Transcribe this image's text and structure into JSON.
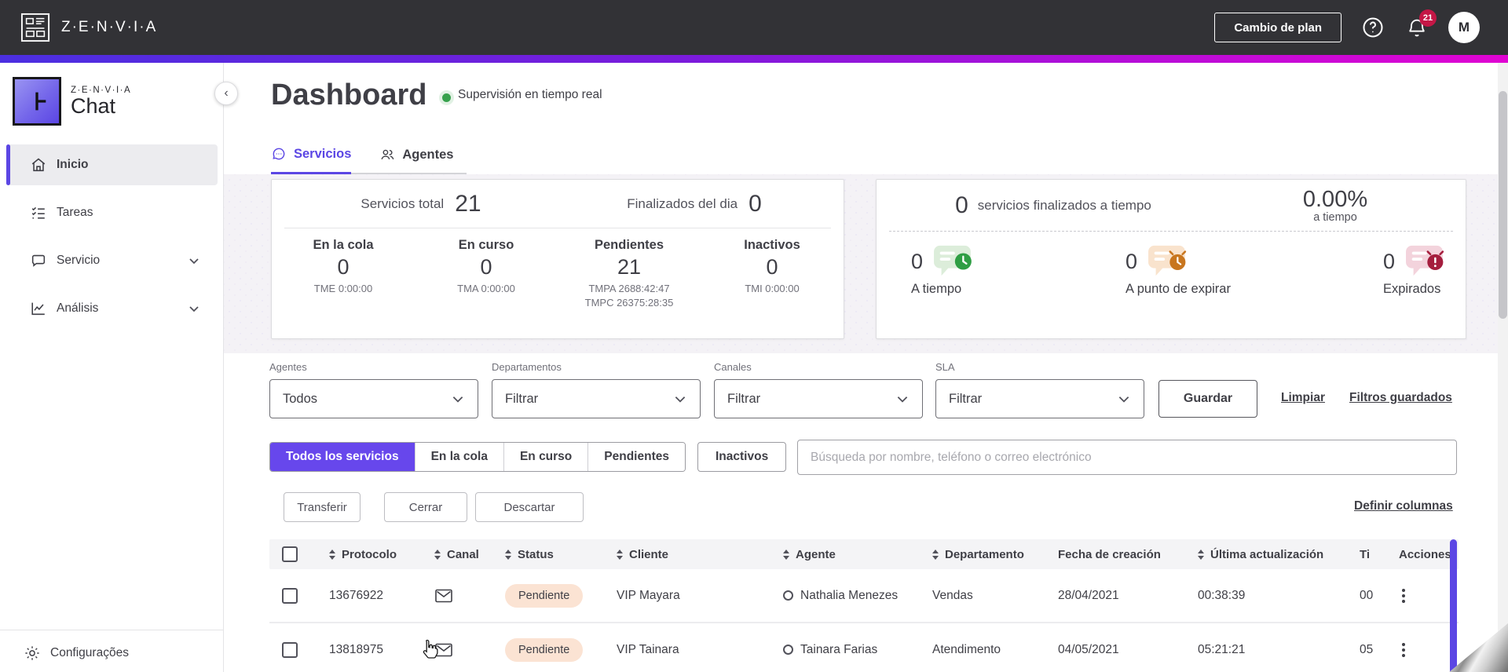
{
  "colors": {
    "accent": "#5b46e4",
    "active_segment": "#6747ec",
    "topbar_bg": "#323236",
    "gradient_start": "#4b2fe0",
    "gradient_end": "#e003d2",
    "status_green": "#36a14c",
    "badge_bg": "#fbe3d3",
    "sla_green": "#2f9e44",
    "sla_orange": "#c8761f",
    "sla_red": "#a51e3e"
  },
  "topbar": {
    "brand": "Z·E·N·V·I·A",
    "change_plan_label": "Cambio de plan",
    "notification_count": "21",
    "avatar_initial": "M"
  },
  "sidebar": {
    "brand": "Z·E·N·V·I·A",
    "product": "Chat",
    "items": [
      {
        "label": "Inicio"
      },
      {
        "label": "Tareas"
      },
      {
        "label": "Servicio"
      },
      {
        "label": "Análisis"
      }
    ],
    "footer_label": "Configurações"
  },
  "header": {
    "title": "Dashboard",
    "status": "Supervisión en tiempo real"
  },
  "tabs": {
    "services": "Servicios",
    "agents": "Agentes"
  },
  "summary": {
    "total_label": "Servicios total",
    "total_value": "21",
    "finished_label": "Finalizados del dia",
    "finished_value": "0",
    "columns": [
      {
        "label": "En la cola",
        "value": "0",
        "metrics": [
          "TME 0:00:00"
        ]
      },
      {
        "label": "En curso",
        "value": "0",
        "metrics": [
          "TMA 0:00:00"
        ]
      },
      {
        "label": "Pendientes",
        "value": "21",
        "metrics": [
          "TMPA 2688:42:47",
          "TMPC 26375:28:35"
        ]
      },
      {
        "label": "Inactivos",
        "value": "0",
        "metrics": [
          "TMI 0:00:00"
        ]
      }
    ]
  },
  "sla": {
    "finished_value": "0",
    "finished_label": "servicios finalizados a tiempo",
    "percent": "0.00%",
    "percent_label": "a tiempo",
    "items": [
      {
        "value": "0",
        "label": "A tiempo"
      },
      {
        "value": "0",
        "label": "A punto de expirar"
      },
      {
        "value": "0",
        "label": "Expirados"
      }
    ]
  },
  "filters": {
    "agents_label": "Agentes",
    "agents_value": "Todos",
    "departments_label": "Departamentos",
    "departments_value": "Filtrar",
    "channels_label": "Canales",
    "channels_value": "Filtrar",
    "sla_label": "SLA",
    "sla_value": "Filtrar",
    "save_label": "Guardar",
    "clear_label": "Limpiar",
    "saved_label": "Filtros guardados"
  },
  "service_tabs": {
    "all": "Todos los servicios",
    "queue": "En la cola",
    "in_progress": "En curso",
    "pending": "Pendientes",
    "inactive": "Inactivos",
    "search_placeholder": "Búsqueda por nombre, teléfono o correo electrónico"
  },
  "actions": {
    "transfer": "Transferir",
    "close": "Cerrar",
    "discard": "Descartar",
    "define_columns": "Definir columnas"
  },
  "table": {
    "headers": {
      "protocol": "Protocolo",
      "channel": "Canal",
      "status": "Status",
      "client": "Cliente",
      "agent": "Agente",
      "department": "Departamento",
      "created": "Fecha de creación",
      "updated": "Última actualización",
      "time": "Ti",
      "actions": "Acciones"
    },
    "rows": [
      {
        "protocolo": "13676922",
        "status": "Pendiente",
        "cliente": "VIP Mayara",
        "agente": "Nathalia Menezes",
        "departamento": "Vendas",
        "fecha": "28/04/2021",
        "ultima": "00:38:39",
        "tiempo": "00"
      },
      {
        "protocolo": "13818975",
        "status": "Pendiente",
        "cliente": "VIP Tainara",
        "agente": "Tainara Farias",
        "departamento": "Atendimento",
        "fecha": "04/05/2021",
        "ultima": "05:21:21",
        "tiempo": "05"
      }
    ]
  }
}
